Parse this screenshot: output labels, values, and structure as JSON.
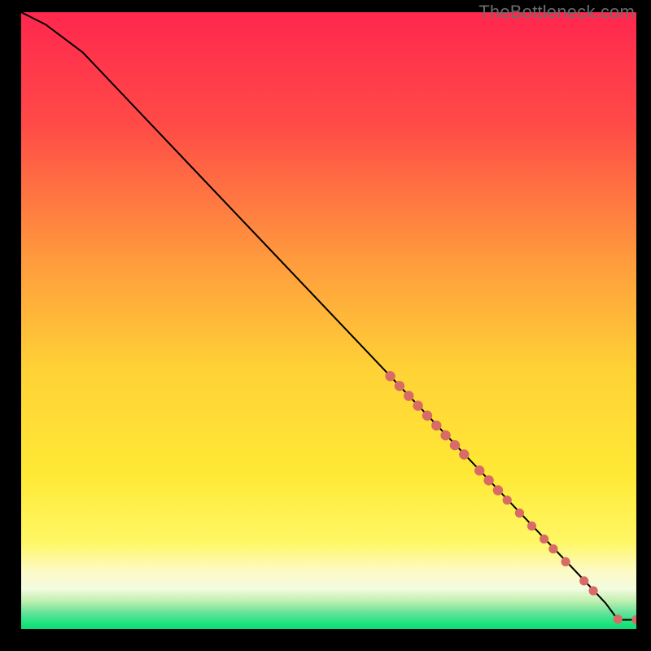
{
  "watermark": "TheBottleneck.com",
  "colors": {
    "top": "#ff274e",
    "mid_upper": "#ff8a3c",
    "mid": "#ffde32",
    "mid_lower": "#fff23a",
    "pale": "#fcf9c8",
    "green": "#1fe57f",
    "marker": "#d86b66",
    "line": "#000000"
  },
  "chart_data": {
    "type": "line",
    "title": "",
    "xlabel": "",
    "ylabel": "",
    "xlim": [
      0,
      100
    ],
    "ylim": [
      0,
      100
    ],
    "series": [
      {
        "name": "curve",
        "x": [
          0,
          4,
          10,
          20,
          30,
          40,
          50,
          60,
          70,
          80,
          90,
          95,
          97,
          100
        ],
        "y": [
          100,
          98,
          93.5,
          83,
          72.5,
          62,
          51.5,
          41,
          30.5,
          20,
          9.5,
          4.2,
          1.5,
          1.5
        ]
      }
    ],
    "markers": {
      "name": "segment-points",
      "x": [
        60,
        61.5,
        63,
        64.5,
        66,
        67.5,
        69,
        70.5,
        72,
        74.5,
        76,
        77.5,
        79,
        81,
        83,
        85,
        86.5,
        88.5,
        91.5,
        93,
        97,
        100
      ],
      "y": [
        41,
        39.4,
        37.8,
        36.2,
        34.6,
        33,
        31.4,
        29.8,
        28.3,
        25.7,
        24.1,
        22.5,
        20.9,
        18.8,
        16.7,
        14.6,
        13,
        10.9,
        7.8,
        6.2,
        1.6,
        1.5
      ]
    }
  }
}
